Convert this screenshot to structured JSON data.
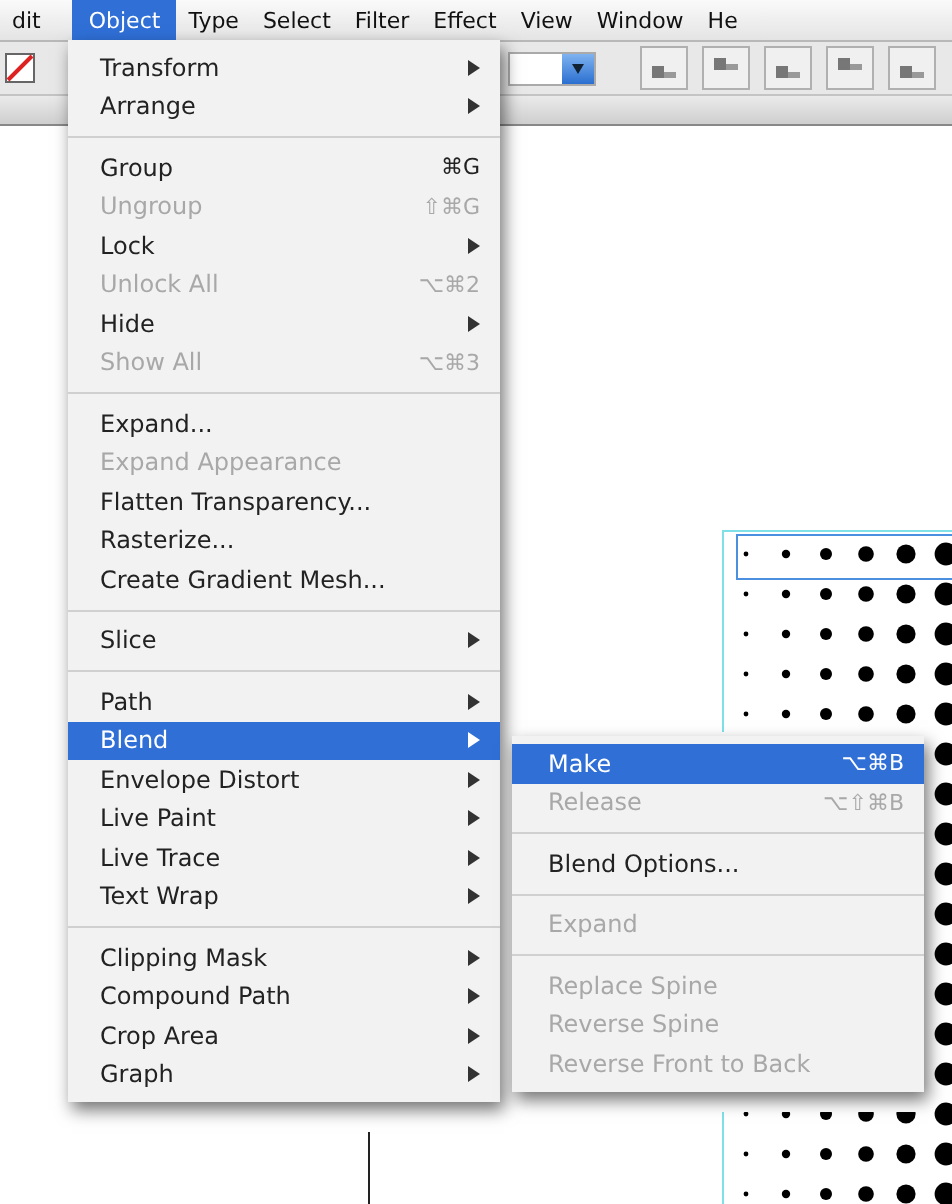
{
  "menubar": [
    {
      "label": "dit",
      "selected": false
    },
    {
      "label": "Object",
      "selected": true
    },
    {
      "label": "Type",
      "selected": false
    },
    {
      "label": "Select",
      "selected": false
    },
    {
      "label": "Filter",
      "selected": false
    },
    {
      "label": "Effect",
      "selected": false
    },
    {
      "label": "View",
      "selected": false
    },
    {
      "label": "Window",
      "selected": false
    },
    {
      "label": "He",
      "selected": false
    }
  ],
  "object_menu": {
    "sections": [
      [
        {
          "label": "Transform",
          "submenu": true,
          "disabled": false,
          "selected": false
        },
        {
          "label": "Arrange",
          "submenu": true,
          "disabled": false,
          "selected": false
        }
      ],
      [
        {
          "label": "Group",
          "shortcut": "⌘G",
          "submenu": false,
          "disabled": false,
          "selected": false
        },
        {
          "label": "Ungroup",
          "shortcut": "⇧⌘G",
          "submenu": false,
          "disabled": true,
          "selected": false
        },
        {
          "label": "Lock",
          "submenu": true,
          "disabled": false,
          "selected": false
        },
        {
          "label": "Unlock All",
          "shortcut": "⌥⌘2",
          "submenu": false,
          "disabled": true,
          "selected": false
        },
        {
          "label": "Hide",
          "submenu": true,
          "disabled": false,
          "selected": false
        },
        {
          "label": "Show All",
          "shortcut": "⌥⌘3",
          "submenu": false,
          "disabled": true,
          "selected": false
        }
      ],
      [
        {
          "label": "Expand...",
          "submenu": false,
          "disabled": false,
          "selected": false
        },
        {
          "label": "Expand Appearance",
          "submenu": false,
          "disabled": true,
          "selected": false
        },
        {
          "label": "Flatten Transparency...",
          "submenu": false,
          "disabled": false,
          "selected": false
        },
        {
          "label": "Rasterize...",
          "submenu": false,
          "disabled": false,
          "selected": false
        },
        {
          "label": "Create Gradient Mesh...",
          "submenu": false,
          "disabled": false,
          "selected": false
        }
      ],
      [
        {
          "label": "Slice",
          "submenu": true,
          "disabled": false,
          "selected": false
        }
      ],
      [
        {
          "label": "Path",
          "submenu": true,
          "disabled": false,
          "selected": false
        },
        {
          "label": "Blend",
          "submenu": true,
          "disabled": false,
          "selected": true
        },
        {
          "label": "Envelope Distort",
          "submenu": true,
          "disabled": false,
          "selected": false
        },
        {
          "label": "Live Paint",
          "submenu": true,
          "disabled": false,
          "selected": false
        },
        {
          "label": "Live Trace",
          "submenu": true,
          "disabled": false,
          "selected": false
        },
        {
          "label": "Text Wrap",
          "submenu": true,
          "disabled": false,
          "selected": false
        }
      ],
      [
        {
          "label": "Clipping Mask",
          "submenu": true,
          "disabled": false,
          "selected": false
        },
        {
          "label": "Compound Path",
          "submenu": true,
          "disabled": false,
          "selected": false
        },
        {
          "label": "Crop Area",
          "submenu": true,
          "disabled": false,
          "selected": false
        },
        {
          "label": "Graph",
          "submenu": true,
          "disabled": false,
          "selected": false
        }
      ]
    ]
  },
  "blend_submenu": {
    "sections": [
      [
        {
          "label": "Make",
          "shortcut": "⌥⌘B",
          "disabled": false,
          "selected": true
        },
        {
          "label": "Release",
          "shortcut": "⌥⇧⌘B",
          "disabled": true,
          "selected": false
        }
      ],
      [
        {
          "label": "Blend Options...",
          "disabled": false,
          "selected": false
        }
      ],
      [
        {
          "label": "Expand",
          "disabled": true,
          "selected": false
        }
      ],
      [
        {
          "label": "Replace Spine",
          "disabled": true,
          "selected": false
        },
        {
          "label": "Reverse Spine",
          "disabled": true,
          "selected": false
        },
        {
          "label": "Reverse Front to Back",
          "disabled": true,
          "selected": false
        }
      ]
    ]
  }
}
